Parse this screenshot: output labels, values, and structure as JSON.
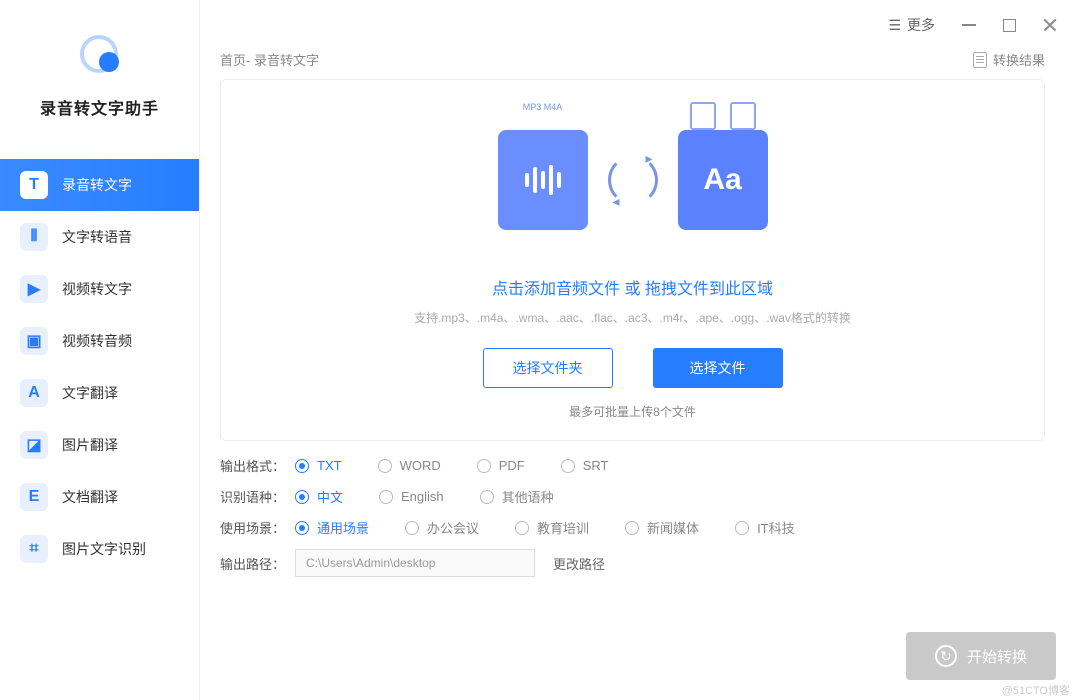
{
  "app_name": "录音转文字助手",
  "titlebar": {
    "more": "更多"
  },
  "sidebar": {
    "items": [
      {
        "label": "录音转文字",
        "glyph": "T"
      },
      {
        "label": "文字转语音",
        "glyph": "⦀"
      },
      {
        "label": "视频转文字",
        "glyph": "▶"
      },
      {
        "label": "视频转音频",
        "glyph": "▣"
      },
      {
        "label": "文字翻译",
        "glyph": "A"
      },
      {
        "label": "图片翻译",
        "glyph": "◪"
      },
      {
        "label": "文档翻译",
        "glyph": "E"
      },
      {
        "label": "图片文字识别",
        "glyph": "⌗"
      }
    ]
  },
  "breadcrumb": "首页- 录音转文字",
  "result_link": "转换结果",
  "panel": {
    "illus_right": "Aa",
    "drop_title": "点击添加音频文件 或 拖拽文件到此区域",
    "drop_hint": "支持.mp3、.m4a、.wma、.aac、.flac、.ac3、.m4r、.ape、.ogg、.wav格式的转换",
    "choose_folder": "选择文件夹",
    "choose_file": "选择文件",
    "note": "最多可批量上传8个文件"
  },
  "options": {
    "format": {
      "label": "输出格式：",
      "items": [
        "TXT",
        "WORD",
        "PDF",
        "SRT"
      ],
      "selected": 0
    },
    "lang": {
      "label": "识别语种：",
      "items": [
        "中文",
        "English",
        "其他语种"
      ],
      "selected": 0
    },
    "scene": {
      "label": "使用场景：",
      "items": [
        "通用场景",
        "办公会议",
        "教育培训",
        "新闻媒体",
        "IT科技"
      ],
      "selected": 0
    },
    "path": {
      "label": "输出路径：",
      "value": "C:\\Users\\Admin\\desktop",
      "change": "更改路径"
    }
  },
  "start": "开始转换",
  "watermark": "@51CTO博客"
}
